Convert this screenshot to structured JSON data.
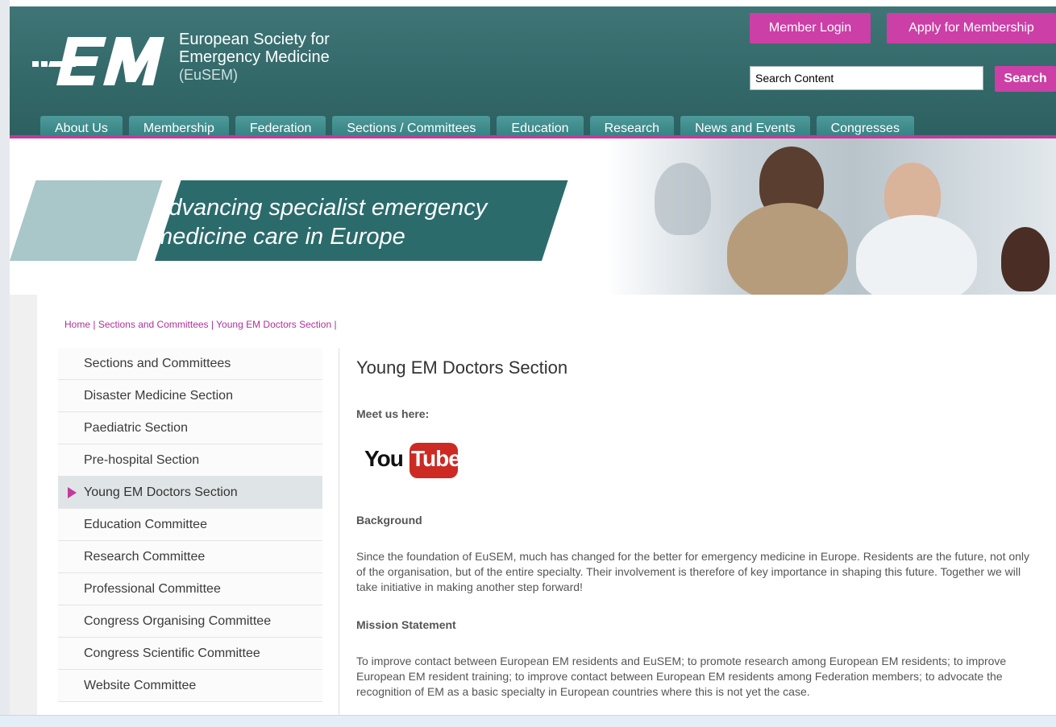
{
  "header": {
    "org_line1": "European Society for",
    "org_line2": "Emergency Medicine",
    "org_abbr": "(EuSEM)",
    "login_label": "Member Login",
    "apply_label": "Apply for Membership",
    "search_value": "Search Content",
    "search_button": "Search"
  },
  "nav": {
    "items": [
      "About Us",
      "Membership",
      "Federation",
      "Sections / Committees",
      "Education",
      "Research",
      "News and Events",
      "Congresses"
    ]
  },
  "banner": {
    "line1": "Advancing specialist emergency",
    "line2": "medicine care in Europe"
  },
  "breadcrumb": {
    "home": "Home",
    "sections": "Sections and Committees",
    "current": "Young EM Doctors Section",
    "sep": "|"
  },
  "sidebar": {
    "items": [
      "Sections and Committees",
      "Disaster Medicine Section",
      "Paediatric Section",
      "Pre-hospital Section",
      "Young EM Doctors Section",
      "Education Committee",
      "Research Committee",
      "Professional Committee",
      "Congress Organising Committee",
      "Congress Scientific Committee",
      "Website Committee"
    ],
    "active_index": 4
  },
  "main": {
    "title": "Young EM Doctors Section",
    "meet": "Meet us here:",
    "yt_you": "You",
    "yt_tube": "Tube",
    "background_heading": "Background",
    "background_text": "Since the foundation of EuSEM, much has changed for the better for emergency medicine in Europe. Residents are the future, not only of the organisation, but of the entire specialty. Their involvement is therefore of key importance in shaping this future. Together we will take initiative in making another step forward!",
    "mission_heading": "Mission Statement",
    "mission_text": "To improve contact between European EM residents and EuSEM; to promote research among European EM residents; to improve European EM resident training; to improve contact between European EM residents among Federation members; to advocate the recognition of EM as a basic specialty in European countries where this is not yet the case."
  },
  "colors": {
    "header_teal": "#336869",
    "accent_magenta": "#cc3fa6",
    "nav_tab": "#3f8b8c"
  }
}
